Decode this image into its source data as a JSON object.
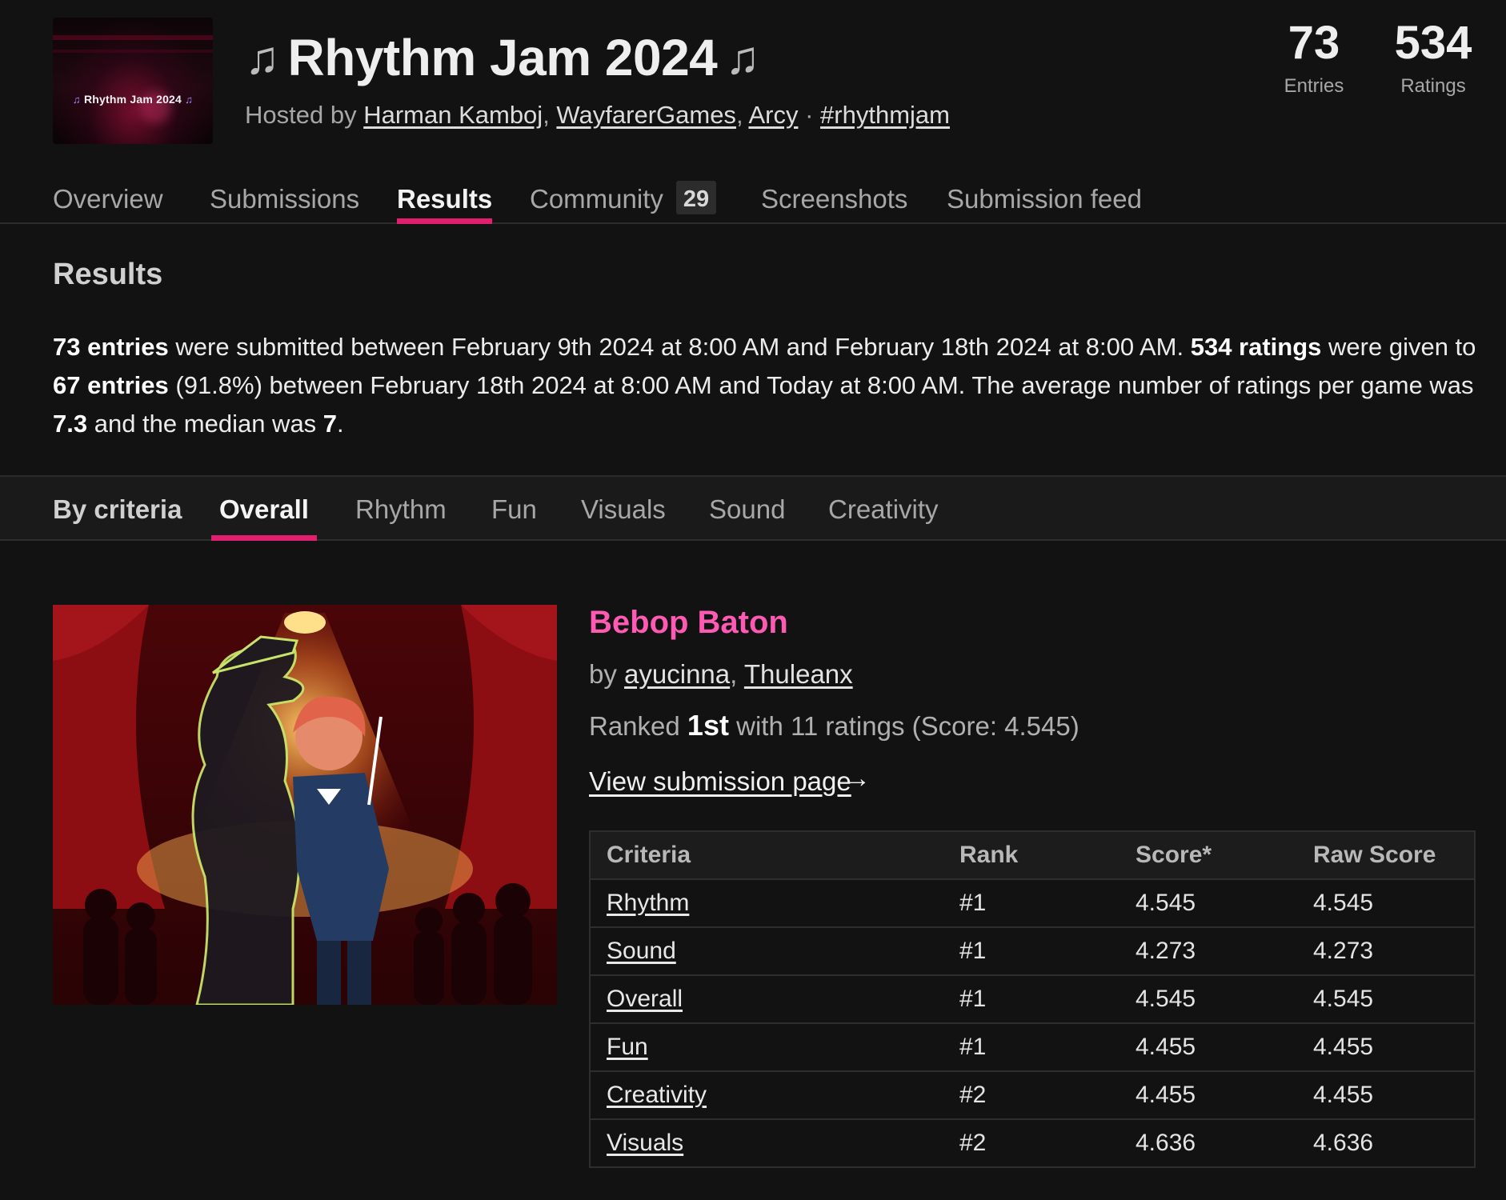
{
  "jam": {
    "thumbnail_text": "Rhythm Jam 2024",
    "title": "Rhythm Jam 2024",
    "hosted_by_label": "Hosted by",
    "hosts": [
      "Harman Kamboj",
      "WayfarerGames",
      "Arcy"
    ],
    "hashtag": "#rhythmjam",
    "separator": "·"
  },
  "stats": {
    "entries_value": "73",
    "entries_label": "Entries",
    "ratings_value": "534",
    "ratings_label": "Ratings"
  },
  "main_nav": {
    "tabs": [
      {
        "label": "Overview"
      },
      {
        "label": "Submissions"
      },
      {
        "label": "Results",
        "active": true
      },
      {
        "label": "Community",
        "badge": "29"
      },
      {
        "label": "Screenshots"
      },
      {
        "label": "Submission feed"
      }
    ]
  },
  "results": {
    "heading": "Results",
    "summary": {
      "entries_bold": "73 entries",
      "text1": " were submitted between February 9th 2024 at 8:00 AM and February 18th 2024 at 8:00 AM. ",
      "ratings_bold": "534 ratings",
      "text2": " were given to ",
      "rated_entries_bold": "67 entries",
      "text3": " (91.8%) between February 18th 2024 at 8:00 AM and Today at 8:00 AM. The average number of ratings per game was ",
      "average_bold": "7.3",
      "text4": " and the median was ",
      "median_bold": "7",
      "text5": "."
    }
  },
  "criteria_nav": {
    "label": "By criteria",
    "tabs": [
      {
        "label": "Overall",
        "active": true
      },
      {
        "label": "Rhythm"
      },
      {
        "label": "Fun"
      },
      {
        "label": "Visuals"
      },
      {
        "label": "Sound"
      },
      {
        "label": "Creativity"
      }
    ]
  },
  "entry": {
    "title": "Bebop Baton",
    "by_label": "by",
    "authors": [
      "ayucinna",
      "Thuleanx"
    ],
    "ranked_prefix": "Ranked",
    "rank": "1st",
    "ranked_suffix": "with 11 ratings (Score: 4.545)",
    "view_link": "View submission page",
    "arrow": "→",
    "table": {
      "headers": [
        "Criteria",
        "Rank",
        "Score*",
        "Raw Score"
      ],
      "rows": [
        {
          "criteria": "Rhythm",
          "rank": "#1",
          "score": "4.545",
          "raw": "4.545"
        },
        {
          "criteria": "Sound",
          "rank": "#1",
          "score": "4.273",
          "raw": "4.273"
        },
        {
          "criteria": "Overall",
          "rank": "#1",
          "score": "4.545",
          "raw": "4.545"
        },
        {
          "criteria": "Fun",
          "rank": "#1",
          "score": "4.455",
          "raw": "4.455"
        },
        {
          "criteria": "Creativity",
          "rank": "#2",
          "score": "4.455",
          "raw": "4.455"
        },
        {
          "criteria": "Visuals",
          "rank": "#2",
          "score": "4.636",
          "raw": "4.636"
        }
      ]
    }
  },
  "colors": {
    "accent": "#e0206f",
    "title_pink": "#ff5ab3",
    "background": "#121212"
  },
  "icons": {
    "music_notes": "♫"
  }
}
